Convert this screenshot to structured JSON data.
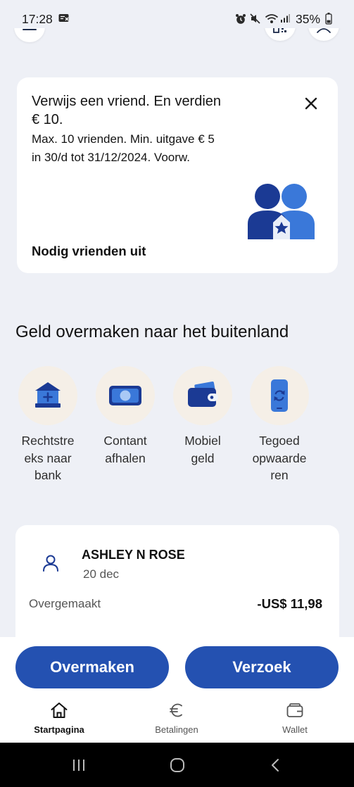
{
  "status_bar": {
    "time": "17:28",
    "battery": "35%",
    "battery_level": 0.35,
    "icons": [
      "notification-icon",
      "alarm-icon",
      "mute-icon",
      "wifi-icon",
      "signal-icon",
      "battery-icon"
    ]
  },
  "header": {
    "buttons": [
      {
        "icon": "menu-icon"
      },
      {
        "icon": "qr-icon"
      },
      {
        "icon": "profile-icon"
      }
    ]
  },
  "promo": {
    "title_lines": [
      "Verwijs een vriend. En verdien",
      "€ 10."
    ],
    "subtitle_lines": [
      "Max. 10 vrienden. Min. uitgave € 5",
      "in 30/d tot 31/12/2024. Voorw."
    ],
    "cta": "Nodig vrienden uit",
    "close_icon": "close-icon",
    "illustration_icon": "friends-illustration"
  },
  "transfer_section": {
    "title": "Geld overmaken naar het buitenland",
    "options": [
      {
        "icon": "bank-icon",
        "label_lines": [
          "Rechtstre",
          "eks naar",
          "bank"
        ]
      },
      {
        "icon": "cash-icon",
        "label_lines": [
          "Contant",
          "afhalen"
        ]
      },
      {
        "icon": "mobile-wallet-icon",
        "label_lines": [
          "Mobiel",
          "geld"
        ]
      },
      {
        "icon": "phone-topup-icon",
        "label_lines": [
          "Tegoed",
          "opwaarde",
          "ren"
        ]
      }
    ]
  },
  "recent_activity": {
    "icon": "person-icon",
    "name": "ASHLEY N ROSE",
    "date": "20 dec",
    "status": "Overgemaakt",
    "amount": "-US$ 11,98"
  },
  "actions": {
    "send_label": "Overmaken",
    "request_label": "Verzoek"
  },
  "bottom_nav": {
    "items": [
      {
        "icon": "home-icon",
        "label": "Startpagina",
        "active": true
      },
      {
        "icon": "euro-icon",
        "label": "Betalingen",
        "active": false
      },
      {
        "icon": "wallet-icon",
        "label": "Wallet",
        "active": false
      }
    ]
  },
  "system_nav": {
    "icons": [
      "recents-icon",
      "home-circle-icon",
      "back-icon"
    ]
  },
  "colors": {
    "background": "#eef0f6",
    "card": "#ffffff",
    "primary_button": "#2451b1",
    "navy": "#1b3a94",
    "light_blue": "#3a78d9",
    "tile": "#f5efe7",
    "text": "#151515",
    "muted_text": "#555555"
  }
}
